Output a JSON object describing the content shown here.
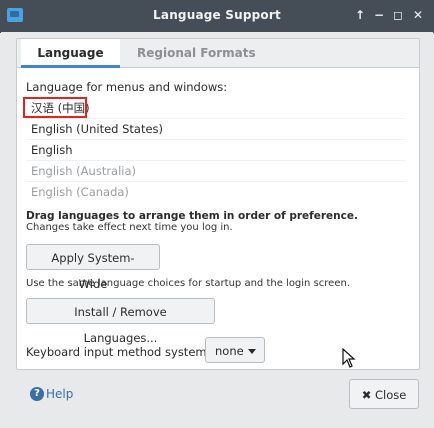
{
  "window": {
    "title": "Language Support",
    "controls": [
      "↑",
      "−",
      "◻",
      "✕"
    ]
  },
  "tabs": [
    {
      "label": "Language",
      "active": true
    },
    {
      "label": "Regional Formats",
      "active": false
    }
  ],
  "language_panel": {
    "section_label": "Language for menus and windows:",
    "languages": [
      {
        "label": "汉语 (中国)",
        "enabled": true,
        "highlighted": true
      },
      {
        "label": "English (United States)",
        "enabled": true
      },
      {
        "label": "English",
        "enabled": true
      },
      {
        "label": "English (Australia)",
        "enabled": false
      },
      {
        "label": "English (Canada)",
        "enabled": false
      }
    ],
    "drag_hint": "Drag languages to arrange them in order of preference.",
    "effect_hint": "Changes take effect next time you log in.",
    "apply_button": "Apply System-Wide",
    "apply_note": "Use the same language choices for startup and the login screen.",
    "install_button": "Install / Remove Languages...",
    "keyboard_label": "Keyboard input method system:",
    "keyboard_value": "none"
  },
  "footer": {
    "help_label": "Help",
    "close_label": "Close"
  },
  "colors": {
    "titlebar": "#454d57",
    "accent": "#3b88c3",
    "highlight_border": "#e0251f",
    "link": "#3b6ea5"
  }
}
